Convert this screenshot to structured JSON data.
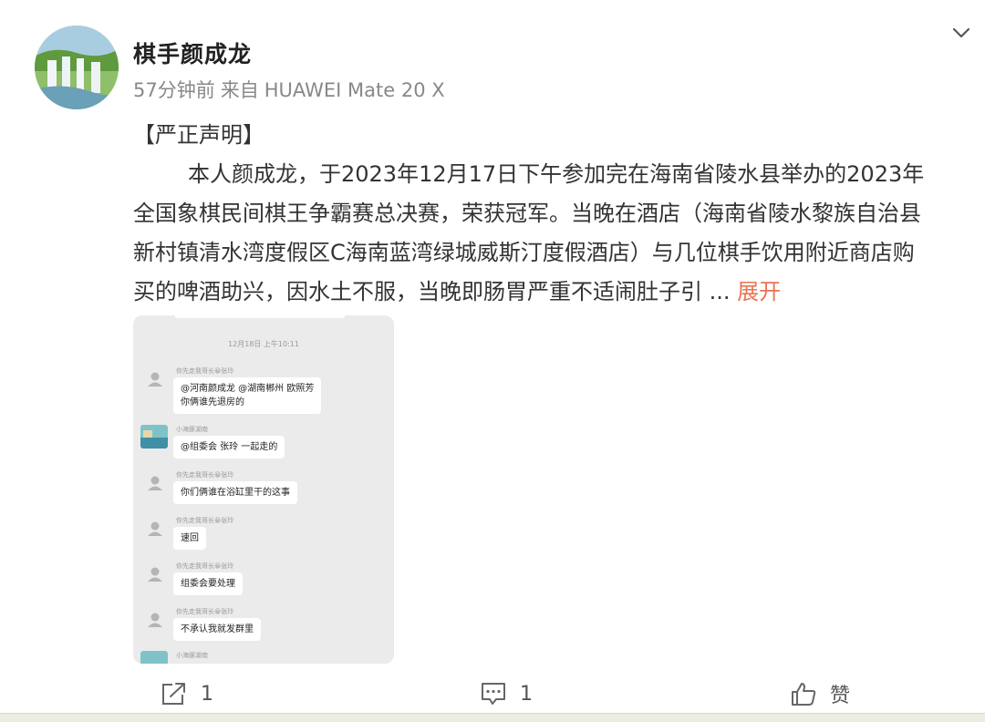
{
  "post": {
    "username": "棋手颜成龙",
    "time": "57分钟前",
    "source_prefix": "来自",
    "device": "HUAWEI Mate 20 X",
    "content_lines": [
      "【严正声明】",
      "本人颜成龙，于2023年12月17日下午参加完在海南省陵水县举办的2023年",
      "全国象棋民间棋王争霸赛总决赛，荣获冠军。当晚在酒店（海南省陵水黎族自治县",
      "新村镇清水湾度假区C海南蓝湾绿城威斯汀度假酒店）与几位棋手饮用附近商店购",
      "买的啤酒助兴，因水土不服，当晚即肠胃严重不适闹肚子引"
    ],
    "ellipsis": " ... ",
    "expand_label": "展开"
  },
  "chat_screenshot": {
    "timestamp": "12月18日 上午10:11",
    "messages": [
      {
        "sender": "你先走我哥长😀张玲",
        "text": "@河南颜成龙 @湖南郴州 欧照芳",
        "text2": "你俩谁先退房的"
      },
      {
        "sender": "小海豚湖南",
        "text": "@组委会  张玲  一起走的"
      },
      {
        "sender": "你先走我哥长😀张玲",
        "text": "你们俩谁在浴缸里干的这事"
      },
      {
        "sender": "你先走我哥长😀张玲",
        "text": "速回"
      },
      {
        "sender": "你先走我哥长😀张玲",
        "text": "组委会要处理"
      },
      {
        "sender": "你先走我哥长😀张玲",
        "text": "不承认我就发群里"
      },
      {
        "sender": "小海豚湖南"
      }
    ]
  },
  "actions": {
    "share_count": "1",
    "comment_count": "1",
    "like_label": "赞"
  },
  "colors": {
    "expand_link": "#eb7350",
    "meta_text": "#888888",
    "chat_bg": "#ebebeb"
  },
  "icons": [
    "chevron-down-icon",
    "share-icon",
    "comment-icon",
    "like-icon"
  ]
}
